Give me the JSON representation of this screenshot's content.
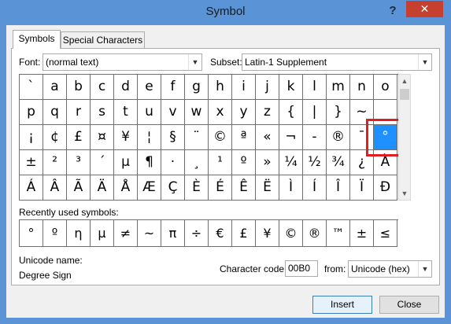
{
  "window": {
    "title": "Symbol",
    "help": "?",
    "close": "✕"
  },
  "tabs": [
    {
      "label": "Symbols",
      "active": true
    },
    {
      "label": "Special Characters",
      "active": false
    }
  ],
  "font": {
    "label": "Font:",
    "value": "(normal text)"
  },
  "subset": {
    "label": "Subset:",
    "value": "Latin-1 Supplement"
  },
  "symbols": [
    [
      "`",
      "a",
      "b",
      "c",
      "d",
      "e",
      "f",
      "g",
      "h",
      "i",
      "j",
      "k",
      "l",
      "m",
      "n",
      "o"
    ],
    [
      "p",
      "q",
      "r",
      "s",
      "t",
      "u",
      "v",
      "w",
      "x",
      "y",
      "z",
      "{",
      "|",
      "}",
      "~",
      ""
    ],
    [
      "¡",
      "¢",
      "£",
      "¤",
      "¥",
      "¦",
      "§",
      "¨",
      "©",
      "ª",
      "«",
      "¬",
      "-",
      "®",
      "¯",
      "°"
    ],
    [
      "±",
      "²",
      "³",
      "´",
      "µ",
      "¶",
      "·",
      "¸",
      "¹",
      "º",
      "»",
      "¼",
      "½",
      "¾",
      "¿",
      "À"
    ],
    [
      "Á",
      "Â",
      "Ã",
      "Ä",
      "Å",
      "Æ",
      "Ç",
      "È",
      "É",
      "Ê",
      "Ë",
      "Ì",
      "Í",
      "Î",
      "Ï",
      "Ð"
    ]
  ],
  "selected": {
    "row": 2,
    "col": 15
  },
  "recent": {
    "label": "Recently used symbols:",
    "items": [
      "°",
      "º",
      "η",
      "µ",
      "≠",
      "~",
      "π",
      "÷",
      "€",
      "£",
      "¥",
      "©",
      "®",
      "™",
      "±",
      "≤"
    ]
  },
  "unicode": {
    "name_label": "Unicode name:",
    "name_value": "Degree Sign"
  },
  "char_code": {
    "label": "Character code:",
    "value": "00B0",
    "from_label": "from:",
    "from_value": "Unicode (hex)"
  },
  "buttons": {
    "insert": "Insert",
    "close": "Close"
  },
  "colors": {
    "titlebar": "#5a93d6",
    "selection": "#1e90ff",
    "highlight": "#e02020"
  }
}
